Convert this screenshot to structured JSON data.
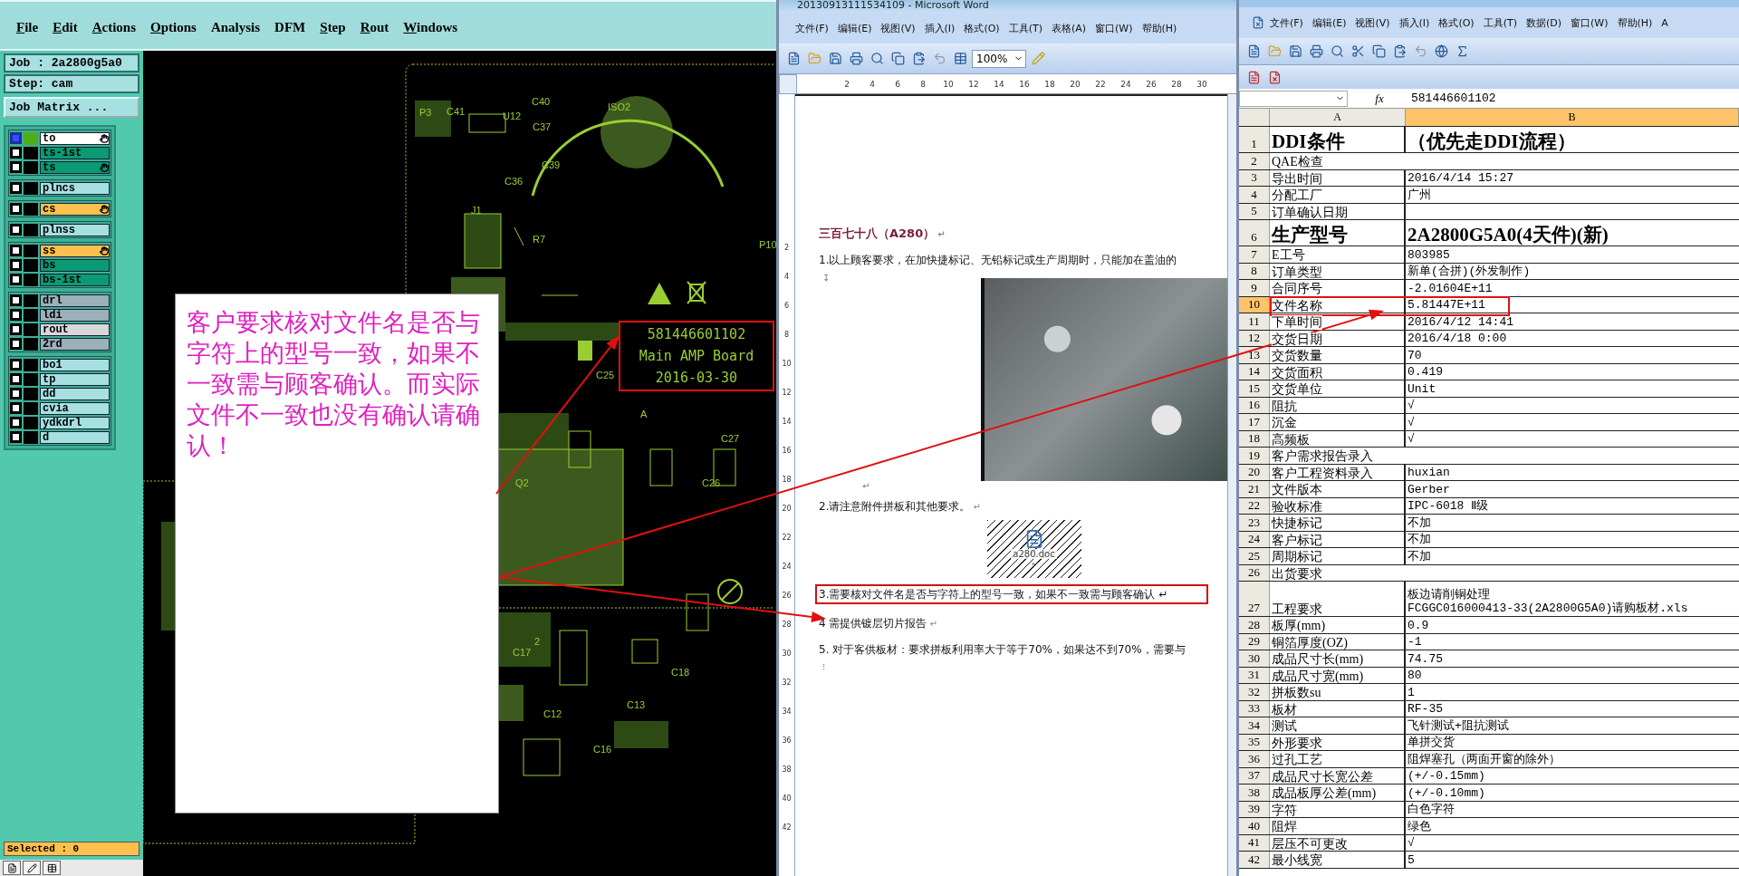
{
  "cam": {
    "menu": [
      {
        "label": "File",
        "mnemonic": true
      },
      {
        "label": "Edit",
        "mnemonic": true
      },
      {
        "label": "Actions",
        "mnemonic": true
      },
      {
        "label": "Options",
        "mnemonic": true
      },
      {
        "label": "Analysis",
        "mnemonic": false
      },
      {
        "label": "DFM",
        "mnemonic": false
      },
      {
        "label": "Step",
        "mnemonic": true
      },
      {
        "label": "Rout",
        "mnemonic": true
      },
      {
        "label": "Windows",
        "mnemonic": true
      }
    ],
    "job": "Job : 2a2800g5a0",
    "step": "Step: cam",
    "job_matrix_button": "Job Matrix ...",
    "layer_groups": [
      {
        "layers": [
          {
            "name": "to",
            "color": "#ffffff",
            "selected": true,
            "affected": true
          },
          {
            "name": "ts-1st",
            "color": "#0a9a74",
            "selected": false,
            "affected": false
          },
          {
            "name": "ts",
            "color": "#0a9a74",
            "selected": false,
            "affected": true
          }
        ]
      },
      {
        "layers": [
          {
            "name": "plncs",
            "color": "#a6e0e0",
            "selected": false,
            "affected": false
          }
        ]
      },
      {
        "layers": [
          {
            "name": "cs",
            "color": "#ffc04d",
            "selected": false,
            "affected": true
          }
        ]
      },
      {
        "layers": [
          {
            "name": "plnss",
            "color": "#a6e0e0",
            "selected": false,
            "affected": false
          }
        ]
      },
      {
        "layers": [
          {
            "name": "ss",
            "color": "#ffc04d",
            "selected": false,
            "affected": true
          },
          {
            "name": "bs",
            "color": "#0a9a74",
            "selected": false,
            "affected": false
          },
          {
            "name": "bs-1st",
            "color": "#0a9a74",
            "selected": false,
            "affected": false
          }
        ]
      },
      {
        "layers": [
          {
            "name": "drl",
            "color": "#9bb0b8",
            "selected": false,
            "affected": false
          },
          {
            "name": "ldi",
            "color": "#9bb0b8",
            "selected": false,
            "affected": false
          },
          {
            "name": "rout",
            "color": "#d8d8d8",
            "selected": false,
            "affected": false
          },
          {
            "name": "2rd",
            "color": "#9bb0b8",
            "selected": false,
            "affected": false
          }
        ]
      },
      {
        "layers": [
          {
            "name": "bo1",
            "color": "#a6e0e0",
            "selected": false,
            "affected": false
          },
          {
            "name": "tp",
            "color": "#a6e0e0",
            "selected": false,
            "affected": false
          },
          {
            "name": "dd",
            "color": "#a6e0e0",
            "selected": false,
            "affected": false
          },
          {
            "name": "cvia",
            "color": "#a6e0e0",
            "selected": false,
            "affected": false
          },
          {
            "name": "ydkdrl",
            "color": "#a6e0e0",
            "selected": false,
            "affected": false
          },
          {
            "name": "d",
            "color": "#a6e0e0",
            "selected": false,
            "affected": false
          }
        ]
      }
    ],
    "selected_status": "Selected : 0",
    "pcb_labels": [
      "P3",
      "C41",
      "U12",
      "C40",
      "C37",
      "ISO2",
      "C36",
      "C39",
      "J1",
      "R7",
      "P10",
      "C25",
      "C27",
      "C26",
      "Q2",
      "A",
      "2",
      "C17",
      "C18",
      "C13",
      "C12",
      "C16"
    ],
    "marking_box": [
      "581446601102",
      "Main AMP Board",
      "2016-03-30"
    ],
    "note": "客户要求核对文件名是否与字符上的型号一致，如果不一致需与顾客确认。而实际文件不一致也没有确认请确认！"
  },
  "word": {
    "title": "20130913111534109 - Microsoft Word",
    "menu": [
      "文件(F)",
      "编辑(E)",
      "视图(V)",
      "插入(I)",
      "格式(O)",
      "工具(T)",
      "表格(A)",
      "窗口(W)",
      "帮助(H)"
    ],
    "zoom": "100%",
    "ruler": [
      "2",
      "4",
      "6",
      "8",
      "10",
      "12",
      "14",
      "16",
      "18",
      "20",
      "22",
      "24",
      "26",
      "28",
      "30"
    ],
    "vruler": [
      "2",
      "4",
      "6",
      "8",
      "10",
      "12",
      "14",
      "16",
      "18",
      "20",
      "22",
      "24",
      "26",
      "28",
      "30",
      "32",
      "34",
      "36",
      "38",
      "40",
      "42"
    ],
    "paragraphs": [
      {
        "kind": "heading",
        "text": "三百七十八（A280）",
        "mark": "↵"
      },
      {
        "kind": "text",
        "text": "1.以上顾客要求，在加快捷标记、无铅标记或生产周期时，只能加在盖油的"
      },
      {
        "kind": "anchor",
        "text": "↧"
      },
      {
        "kind": "image"
      },
      {
        "kind": "mark",
        "text": "↵"
      },
      {
        "kind": "text",
        "text": "2.请注意附件拼板和其他要求。",
        "mark": "↵"
      },
      {
        "kind": "object",
        "text": "a280.doc",
        "mark": "↵"
      },
      {
        "kind": "boxed",
        "text": "3.需要核对文件名是否与字符上的型号一致，如果不一致需与顾客确认",
        "mark": "↵"
      },
      {
        "kind": "text",
        "text": "4 需提供镀层切片报告",
        "mark": "↵"
      },
      {
        "kind": "text",
        "text": "5. 对于客供板材：要求拼板利用率大于等于70%，如果达不到70%，需要与"
      },
      {
        "kind": "anchor",
        "text": "⁝"
      }
    ]
  },
  "excel": {
    "menu": [
      "文件(F)",
      "编辑(E)",
      "视图(V)",
      "插入(I)",
      "格式(O)",
      "工具(T)",
      "数据(D)",
      "窗口(W)",
      "帮助(H)",
      "A"
    ],
    "formula": "581446601102",
    "function_label": "fx",
    "columns": [
      {
        "label": "A",
        "selected": false
      },
      {
        "label": "B",
        "selected": true
      }
    ],
    "rows": [
      {
        "num": "1",
        "kind": "large",
        "a": "DDI条件",
        "b": "（优先走DDI流程）",
        "selected": false
      },
      {
        "num": "2",
        "kind": "span",
        "a": "QAE检查",
        "selected": false
      },
      {
        "num": "3",
        "kind": "normal",
        "a": "导出时间",
        "b": "2016/4/14 15:27",
        "selected": false
      },
      {
        "num": "4",
        "kind": "normal",
        "a": "分配工厂",
        "b": "广州",
        "selected": false
      },
      {
        "num": "5",
        "kind": "normal",
        "a": "订单确认日期",
        "selected": false
      },
      {
        "num": "6",
        "kind": "large",
        "a": "生产型号",
        "b": "2A2800G5A0(4天件)(新)",
        "selected": false
      },
      {
        "num": "7",
        "kind": "normal",
        "a": "E工号",
        "b": "803985",
        "selected": false
      },
      {
        "num": "8",
        "kind": "normal",
        "a": "订单类型",
        "b": "新单(合拼)(外发制作)",
        "selected": false
      },
      {
        "num": "9",
        "kind": "normal",
        "a": "合同序号",
        "b": "-2.01604E+11",
        "selected": false
      },
      {
        "num": "10",
        "kind": "normal",
        "a": "文件名称",
        "b": "5.81447E+11",
        "selected": true
      },
      {
        "num": "11",
        "kind": "normal",
        "a": "下单时间",
        "b": "2016/4/12 14:41",
        "selected": false
      },
      {
        "num": "12",
        "kind": "normal",
        "a": "交货日期",
        "b": "2016/4/18 0:00",
        "selected": false
      },
      {
        "num": "13",
        "kind": "normal",
        "a": "交货数量",
        "b": "70",
        "selected": false
      },
      {
        "num": "14",
        "kind": "normal",
        "a": "交货面积",
        "b": "0.419",
        "selected": false
      },
      {
        "num": "15",
        "kind": "normal",
        "a": "交货单位",
        "b": "Unit",
        "selected": false
      },
      {
        "num": "16",
        "kind": "normal",
        "a": "阻抗",
        "b": "√",
        "selected": false
      },
      {
        "num": "17",
        "kind": "normal",
        "a": "沉金",
        "b": "√",
        "selected": false
      },
      {
        "num": "18",
        "kind": "normal",
        "a": "高频板",
        "b": "√",
        "selected": false
      },
      {
        "num": "19",
        "kind": "span",
        "a": "客户需求报告录入",
        "selected": false
      },
      {
        "num": "20",
        "kind": "normal",
        "a": "客户工程资料录入",
        "b": "huxian",
        "selected": false
      },
      {
        "num": "21",
        "kind": "normal",
        "a": "文件版本",
        "b": "Gerber",
        "selected": false
      },
      {
        "num": "22",
        "kind": "normal",
        "a": "验收标准",
        "b": "IPC-6018 Ⅱ级",
        "selected": false
      },
      {
        "num": "23",
        "kind": "normal",
        "a": "快捷标记",
        "b": "不加",
        "selected": false
      },
      {
        "num": "24",
        "kind": "normal",
        "a": "客户标记",
        "b": "不加",
        "selected": false
      },
      {
        "num": "25",
        "kind": "normal",
        "a": "周期标记",
        "b": "不加",
        "selected": false
      },
      {
        "num": "26",
        "kind": "span",
        "a": "出货要求",
        "selected": false
      },
      {
        "num": "27",
        "kind": "double",
        "a": "工程要求",
        "b": [
          "板边请削铜处理",
          "FCGGC016000413-33(2A2800G5A0)请购板材.xls"
        ],
        "selected": false
      },
      {
        "num": "28",
        "kind": "normal",
        "a": "板厚(mm)",
        "b": "0.9",
        "selected": false
      },
      {
        "num": "29",
        "kind": "normal",
        "a": "铜箔厚度(OZ)",
        "b": "-1",
        "selected": false
      },
      {
        "num": "30",
        "kind": "normal",
        "a": "成品尺寸长(mm)",
        "b": "74.75",
        "selected": false
      },
      {
        "num": "31",
        "kind": "normal",
        "a": "成品尺寸宽(mm)",
        "b": "80",
        "selected": false
      },
      {
        "num": "32",
        "kind": "normal",
        "a": "拼板数su",
        "b": "1",
        "selected": false
      },
      {
        "num": "33",
        "kind": "normal",
        "a": "板材",
        "b": "RF-35",
        "selected": false
      },
      {
        "num": "34",
        "kind": "normal",
        "a": "测试",
        "b": "飞针测试+阻抗测试",
        "selected": false
      },
      {
        "num": "35",
        "kind": "normal",
        "a": "外形要求",
        "b": "单拼交货",
        "selected": false
      },
      {
        "num": "36",
        "kind": "normal",
        "a": "过孔工艺",
        "b": "阻焊塞孔（两面开窗的除外）",
        "selected": false
      },
      {
        "num": "37",
        "kind": "normal",
        "a": "成品尺寸长宽公差",
        "b": "(+/-0.15mm)",
        "selected": false
      },
      {
        "num": "38",
        "kind": "normal",
        "a": "成品板厚公差(mm)",
        "b": "(+/-0.10mm)",
        "selected": false
      },
      {
        "num": "39",
        "kind": "normal",
        "a": "字符",
        "b": "白色字符",
        "selected": false
      },
      {
        "num": "40",
        "kind": "normal",
        "a": "阻焊",
        "b": "绿色",
        "selected": false
      },
      {
        "num": "41",
        "kind": "normal",
        "a": "层压不可更改",
        "b": "√",
        "selected": false
      },
      {
        "num": "42",
        "kind": "normal",
        "a": "最小线宽",
        "b": "5",
        "selected": false
      }
    ]
  }
}
